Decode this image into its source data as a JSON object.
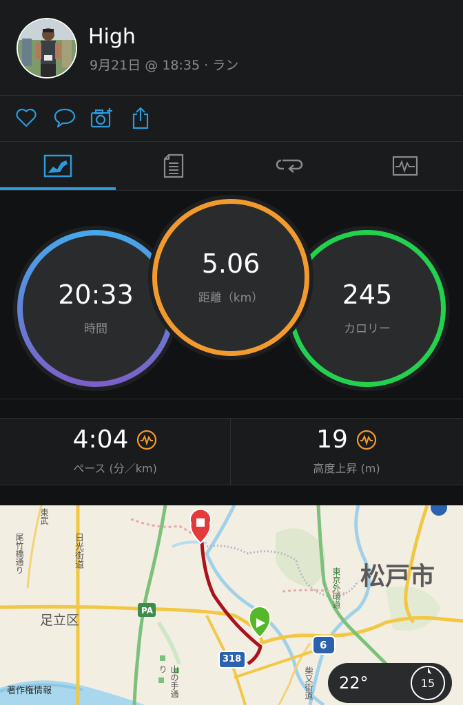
{
  "header": {
    "title": "High",
    "meta": "9月21日 @ 18:35 · ラン"
  },
  "actions": [
    "like-icon",
    "comment-icon",
    "add-photo-icon",
    "share-icon"
  ],
  "tabs": [
    "overview-tab",
    "details-tab",
    "laps-tab",
    "charts-tab"
  ],
  "colors": {
    "accent": "#2c9bdc",
    "time": "#4a9be0",
    "distance": "#f29a2e",
    "calories": "#22d14e",
    "metric": "#f29a2e"
  },
  "metrics": {
    "time": {
      "value": "20:33",
      "label": "時間"
    },
    "distance": {
      "value": "5.06",
      "label": "距離（km）"
    },
    "calories": {
      "value": "245",
      "label": "カロリー"
    }
  },
  "stats": {
    "pace": {
      "value": "4:04",
      "label": "ペース (分／km)"
    },
    "elevation": {
      "value": "19",
      "label": "高度上昇 (m)"
    }
  },
  "map": {
    "city": "松戸市",
    "ward": "足立区",
    "road_nikko": "日光街道",
    "road_ogi": "尾竹橋通り",
    "road_higashi": "東武",
    "road_gaikan": "東京外環道",
    "road_yamanote": "山の手通り",
    "road_shibamata": "柴又街道",
    "pa": "PA",
    "route_318": "318",
    "route_6": "6",
    "copyright": "著作権情報"
  },
  "weather": {
    "temp": "22°",
    "wind": "15"
  }
}
